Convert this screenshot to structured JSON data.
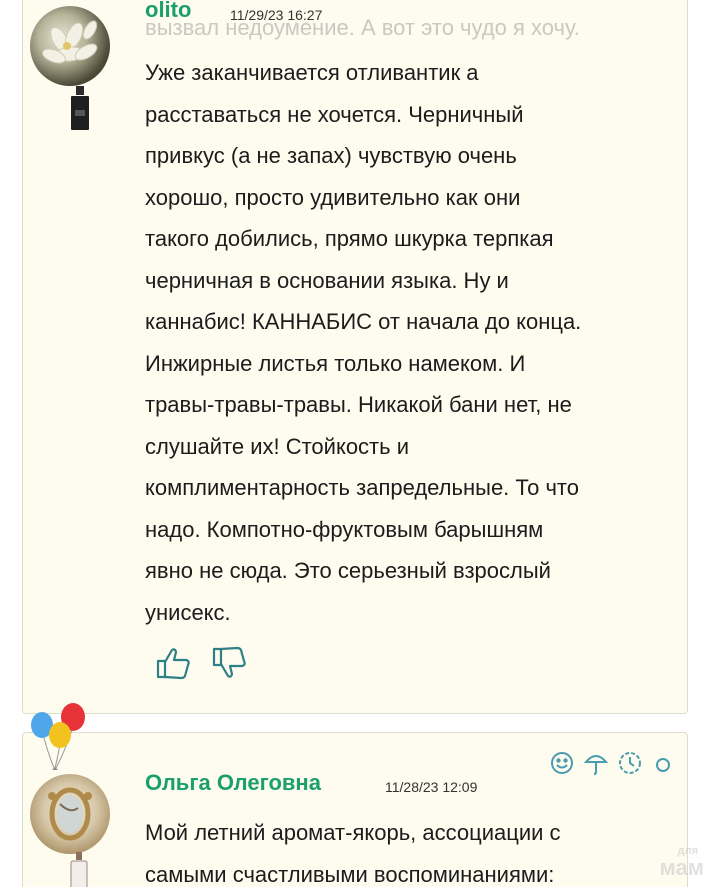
{
  "comment1": {
    "username": "olito",
    "date": "11/29/23 16:27",
    "ghost_line": "вызвал недоумение. А вот это чудо я хочу.",
    "lines": [
      "Уже заканчивается отливантик а",
      "расставаться не хочется. Черничный",
      "привкус (а не запах) чувствую очень",
      "хорошо, просто удивительно как они",
      "такого добились, прямо шкурка терпкая",
      "черничная в основании языка. Ну и",
      "каннабис! КАННАБИС от начала до конца.",
      "Инжирные листья только намеком. И",
      "травы-травы-травы. Никакой бани нет, не",
      "слушайте их! Стойкость и",
      "комплиментарность запредельные. То что",
      "надо. Компотно-фруктовым барышням",
      "явно не сюда. Это серьезный взрослый",
      "унисекс."
    ],
    "avatar_icon": "flower-avatar",
    "badge_icon": "perfume-bottle-icon"
  },
  "comment2": {
    "username": "Ольга Олеговна",
    "date": "11/28/23 12:09",
    "lines": [
      "Мой летний аромат-якорь, ассоциации с",
      "самыми счастливыми воспоминаниями:"
    ],
    "avatar_icon": "mirror-avatar",
    "badge_icon": "perfume-bottle-icon"
  },
  "watermark": {
    "small": "для",
    "big": "мам"
  },
  "colors": {
    "username": "#1ba06d",
    "card_bg": "#fdfcef",
    "stat_icons": "#4a9bb0"
  }
}
